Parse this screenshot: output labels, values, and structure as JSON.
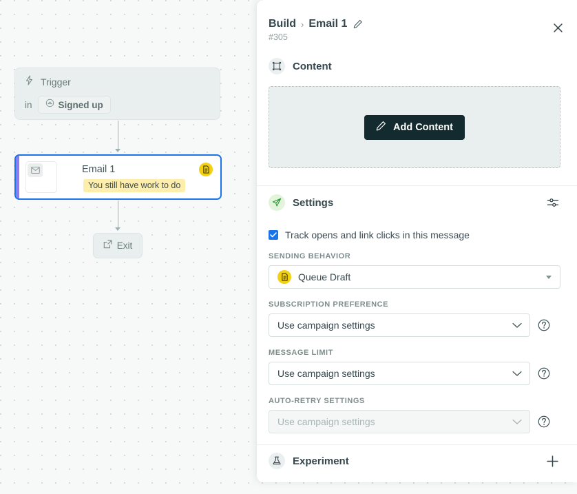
{
  "canvas": {
    "trigger_node": {
      "label": "Trigger",
      "in_label": "in",
      "chip_label": "Signed up",
      "icon": "lightning-icon",
      "chip_icon": "target-circle-icon"
    },
    "email_node": {
      "title": "Email 1",
      "badge": "You still have work to do",
      "thumb_icon": "envelope-icon",
      "status_icon": "draft-document-icon",
      "accent_color": "#8b7cf0",
      "selected_border_color": "#1a73e8",
      "badge_color": "#fdeeab",
      "status_color": "#f4d013"
    },
    "exit_node": {
      "label": "Exit",
      "icon": "external-link-icon"
    }
  },
  "panel": {
    "breadcrumb": {
      "root": "Build",
      "separator": "›",
      "current": "Email 1",
      "edit_icon": "pencil-icon"
    },
    "subtitle_id": "#305",
    "close_icon": "close-icon",
    "content": {
      "title": "Content",
      "icon": "frame-icon",
      "add_button_label": "Add Content",
      "add_button_icon": "pencil-icon",
      "add_button_color": "#132b2e"
    },
    "settings": {
      "title": "Settings",
      "icon": "paper-plane-icon",
      "action_icon": "sliders-icon",
      "accent_color": "#2f9a3e",
      "checkbox": {
        "label": "Track opens and link clicks in this message",
        "checked": true,
        "color": "#1a73e8"
      },
      "fields": [
        {
          "label": "SENDING BEHAVIOR",
          "value": "Queue Draft",
          "badge_icon": "draft-document-icon",
          "badge_color": "#f4d013",
          "disabled": false,
          "has_help": false,
          "caret": "triangle",
          "width": "full"
        },
        {
          "label": "SUBSCRIPTION PREFERENCE",
          "value": "Use campaign settings",
          "disabled": false,
          "has_help": true,
          "help_icon": "question-circle-icon",
          "caret": "chevron",
          "width": "narrow"
        },
        {
          "label": "MESSAGE LIMIT",
          "value": "Use campaign settings",
          "disabled": false,
          "has_help": true,
          "help_icon": "question-circle-icon",
          "caret": "chevron",
          "width": "narrow"
        },
        {
          "label": "AUTO-RETRY SETTINGS",
          "value": "Use campaign settings",
          "disabled": true,
          "has_help": true,
          "help_icon": "question-circle-icon",
          "caret": "chevron",
          "width": "narrow"
        }
      ]
    },
    "experiment": {
      "title": "Experiment",
      "icon": "flask-icon",
      "add_icon": "plus-icon"
    }
  }
}
